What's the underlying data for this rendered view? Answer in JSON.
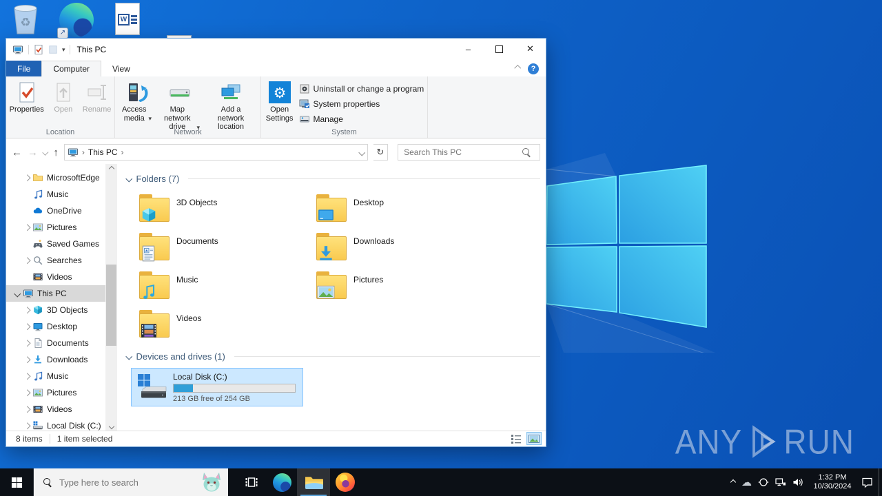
{
  "desktop": {
    "icon_names": [
      "recycle-bin",
      "microsoft-edge",
      "word-document",
      "word-document"
    ],
    "watermark": {
      "left": "ANY",
      "right": "RUN"
    }
  },
  "glyphs": {
    "back": "←",
    "forward": "→",
    "up": "↑",
    "refresh": "↻",
    "dropdown": "▾",
    "crumb_sep": "›",
    "help": "?",
    "minimize": "–",
    "close": "✕",
    "shortcut_arrow": "↗",
    "word_letter": "W"
  },
  "colors": {
    "accent_blue": "#2062b4",
    "selection_blue": "#cce8ff",
    "disk_fill": "#2f9fd8",
    "taskbar": "#0c1016",
    "desktop_blue": "#0e62c8"
  },
  "window": {
    "title": "This PC",
    "tabs": {
      "file": "File",
      "computer": "Computer",
      "view": "View"
    },
    "ribbon": {
      "location": {
        "label": "Location",
        "properties": "Properties",
        "open": "Open",
        "rename": "Rename"
      },
      "network": {
        "label": "Network",
        "access_media": "Access media",
        "map_drive": "Map network drive",
        "add_location": "Add a network location"
      },
      "system": {
        "label": "System",
        "open_settings": "Open Settings",
        "uninstall": "Uninstall or change a program",
        "sys_props": "System properties",
        "manage": "Manage"
      }
    },
    "navbar": {
      "crumb": "This PC",
      "search_placeholder": "Search This PC"
    },
    "sidebar": {
      "items": [
        {
          "label": "MicrosoftEdge",
          "icon": "folder",
          "exp": "closed",
          "level": 2
        },
        {
          "label": "Music",
          "icon": "music",
          "exp": "none",
          "level": 2
        },
        {
          "label": "OneDrive",
          "icon": "onedrive",
          "exp": "none",
          "level": 2
        },
        {
          "label": "Pictures",
          "icon": "pictures",
          "exp": "closed",
          "level": 2
        },
        {
          "label": "Saved Games",
          "icon": "games",
          "exp": "none",
          "level": 2
        },
        {
          "label": "Searches",
          "icon": "search",
          "exp": "closed",
          "level": 2
        },
        {
          "label": "Videos",
          "icon": "videos",
          "exp": "none",
          "level": 2
        },
        {
          "label": "This PC",
          "icon": "pc",
          "exp": "open",
          "level": 1,
          "selected": true
        },
        {
          "label": "3D Objects",
          "icon": "cube",
          "exp": "closed",
          "level": 2
        },
        {
          "label": "Desktop",
          "icon": "desktop",
          "exp": "closed",
          "level": 2
        },
        {
          "label": "Documents",
          "icon": "docs",
          "exp": "closed",
          "level": 2
        },
        {
          "label": "Downloads",
          "icon": "down",
          "exp": "closed",
          "level": 2
        },
        {
          "label": "Music",
          "icon": "music",
          "exp": "closed",
          "level": 2
        },
        {
          "label": "Pictures",
          "icon": "pictures",
          "exp": "closed",
          "level": 2
        },
        {
          "label": "Videos",
          "icon": "videos",
          "exp": "closed",
          "level": 2
        },
        {
          "label": "Local Disk (C:)",
          "icon": "disk",
          "exp": "closed",
          "level": 2
        }
      ]
    },
    "content": {
      "folders": {
        "title": "Folders (7)",
        "items": [
          {
            "label": "3D Objects",
            "icon": "cube"
          },
          {
            "label": "Desktop",
            "icon": "desktop"
          },
          {
            "label": "Documents",
            "icon": "docs"
          },
          {
            "label": "Downloads",
            "icon": "down"
          },
          {
            "label": "Music",
            "icon": "music"
          },
          {
            "label": "Pictures",
            "icon": "pics"
          },
          {
            "label": "Videos",
            "icon": "videos"
          }
        ]
      },
      "devices": {
        "title": "Devices and drives (1)",
        "drive": {
          "name": "Local Disk (C:)",
          "free_text": "213 GB free of 254 GB",
          "used_percent": 16
        }
      }
    },
    "statusbar": {
      "count": "8 items",
      "selected": "1 item selected"
    }
  },
  "taskbar": {
    "search_placeholder": "Type here to search",
    "clock": {
      "time": "1:32 PM",
      "date": "10/30/2024"
    }
  }
}
